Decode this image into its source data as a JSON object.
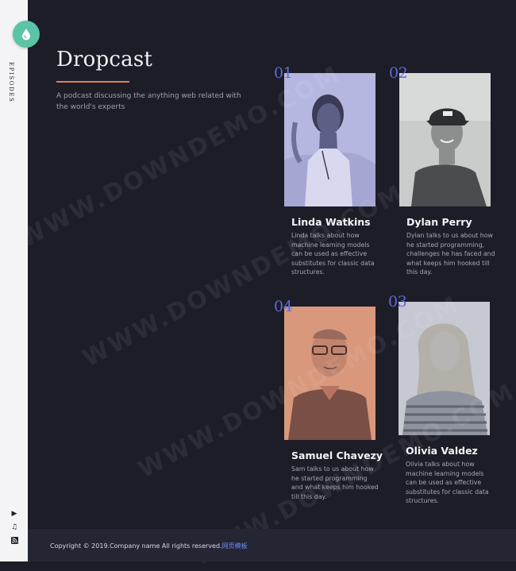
{
  "rail": {
    "label": "EPISODES",
    "icons": [
      "play-icon",
      "music-icon",
      "rss-icon"
    ]
  },
  "header": {
    "title": "Dropcast",
    "subtitle": "A podcast discussing the anything web related with the world's experts"
  },
  "episodes": [
    {
      "number": "01",
      "name": "Linda Watkins",
      "description": "Linda talks about how machine learning models can be used as effective substitutes for classic data structures.",
      "tint": "#b4b5de"
    },
    {
      "number": "02",
      "name": "Dylan Perry",
      "description": "Dylan talks to us about how he started programming, challenges he has faced and what keeps him hooked till this day.",
      "tint": "#b9bdbd"
    },
    {
      "number": "04",
      "name": "Samuel Chavezy",
      "description": "Sam talks to us about how he started programming and what keeps him hooked till this day.",
      "tint": "#d9977a"
    },
    {
      "number": "03",
      "name": "Olivia Valdez",
      "description": "Olivia talks about how machine learning models can be used as effective substitutes for classic data structures.",
      "tint": "#c3c5cf"
    }
  ],
  "footer": {
    "copyright": "Copyright © 2019.Company name All rights reserved.",
    "link": "网页模板"
  },
  "watermark": "WWW.DOWNDEMO.COM",
  "colors": {
    "background": "#1c1d27",
    "rail": "#f4f4f6",
    "logo": "#5cc3a6",
    "accent_rule": "#e07f60",
    "number": "#5f6ad9",
    "footer": "#252633"
  }
}
